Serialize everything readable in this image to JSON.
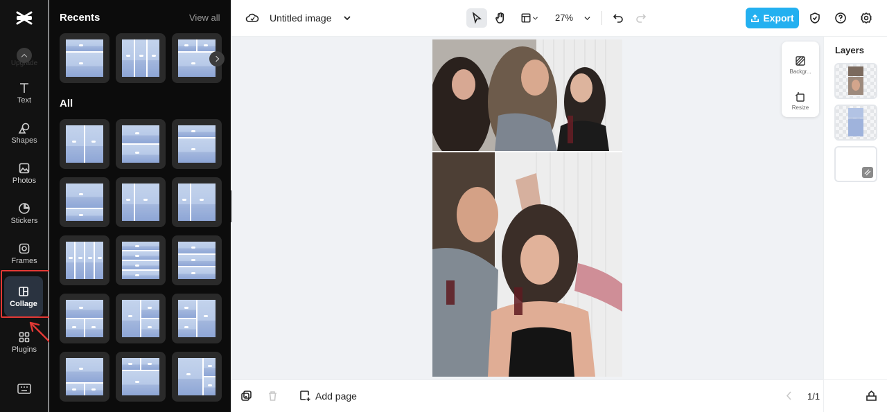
{
  "app": {
    "rail": {
      "upgrade_label": "Upgrade",
      "items": [
        {
          "label": "Text"
        },
        {
          "label": "Shapes"
        },
        {
          "label": "Photos"
        },
        {
          "label": "Stickers"
        },
        {
          "label": "Frames"
        },
        {
          "label": "Collage"
        },
        {
          "label": "Plugins"
        }
      ]
    },
    "panel": {
      "recents_title": "Recents",
      "view_all": "View all",
      "all_title": "All"
    },
    "topbar": {
      "doc_title": "Untitled image",
      "zoom": "27%",
      "export_label": "Export"
    },
    "float_tools": {
      "background_label": "Backgr...",
      "resize_label": "Resize"
    },
    "layers": {
      "title": "Layers"
    },
    "bottombar": {
      "add_page_label": "Add page",
      "page_count": "1/1"
    },
    "colors": {
      "accent": "#23b0f0",
      "active_rail_bg": "#2a3340",
      "highlight": "#e53935"
    }
  }
}
